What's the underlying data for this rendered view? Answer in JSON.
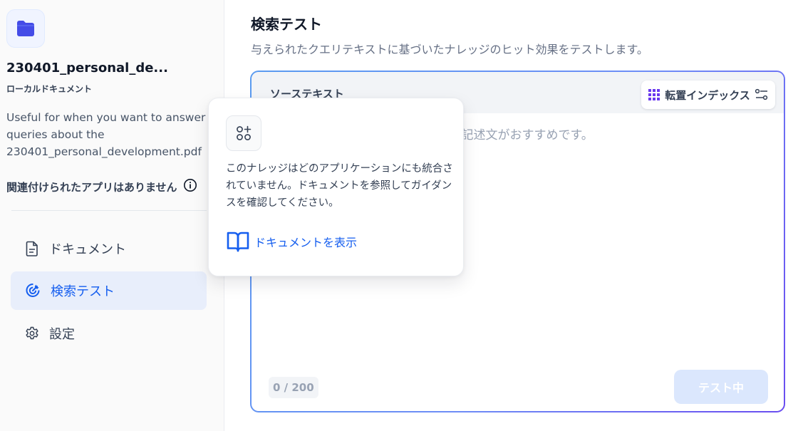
{
  "sidebar": {
    "dataset_name": "230401_personal_de...",
    "dataset_type": "ローカルドキュメント",
    "description_lines": [
      "Useful for when you want to answer",
      "queries about the",
      "230401_personal_development.pdf"
    ],
    "no_apps_label": "関連付けられたアプリはありません",
    "nav": [
      {
        "label": "ドキュメント",
        "icon": "document-icon",
        "active": false
      },
      {
        "label": "検索テスト",
        "icon": "target-icon",
        "active": true
      },
      {
        "label": "設定",
        "icon": "gear-icon",
        "active": false
      }
    ]
  },
  "main": {
    "title": "検索テスト",
    "subtitle": "与えられたクエリテキストに基づいたナレッジのヒット効果をテストします。",
    "source": {
      "label": "ソーステキスト",
      "retrieval_button": "転置インデックス",
      "placeholder": "テキストを入力してください。短い記述文がおすすめです。",
      "value": "",
      "counter": "0 / 200",
      "test_button": "テスト中"
    }
  },
  "popover": {
    "lines": [
      "このナレッジはどのアプリケーションにも統合さ",
      "れていません。ドキュメントを参照してガイダン",
      "スを確認してください。"
    ],
    "link_label": "ドキュメントを表示"
  },
  "colors": {
    "accent": "#155eef",
    "nav_active_bg": "#e8eefb",
    "folder": "#444ce7",
    "gradient_start": "#5a9bf0",
    "gradient_end": "#6a4df0",
    "index_icon": "#6938ef"
  }
}
